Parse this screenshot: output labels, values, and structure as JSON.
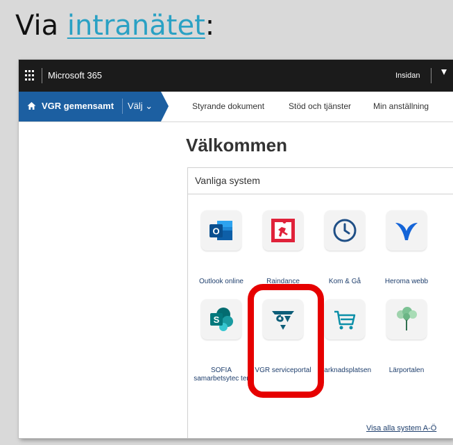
{
  "heading": {
    "prefix": "Via ",
    "link": "intranätet",
    "suffix": ":"
  },
  "suitebar": {
    "app_name": "Microsoft 365",
    "site_link": "Insidan"
  },
  "navbar": {
    "home_label": "VGR gemensamt",
    "select_label": "Välj ⌄",
    "links": [
      "Styrande dokument",
      "Stöd och tjänster",
      "Min anställning"
    ]
  },
  "main": {
    "welcome": "Välkommen",
    "panel_title": "Vanliga system",
    "apps": [
      {
        "label": "Outlook online",
        "icon": "outlook-icon"
      },
      {
        "label": "Raindance",
        "icon": "raindance-icon"
      },
      {
        "label": "Kom & Gå",
        "icon": "clock-icon"
      },
      {
        "label": "Heroma webb",
        "icon": "heroma-icon"
      },
      {
        "label": "SOFIA samarbetsytec ter",
        "icon": "sharepoint-icon"
      },
      {
        "label": "VGR serviceportal",
        "icon": "vgr-icon"
      },
      {
        "label": "Marknadsplatsen",
        "icon": "cart-icon"
      },
      {
        "label": "Lärportalen",
        "icon": "tree-icon"
      }
    ],
    "footer_link": "Visa alla system A-Ö"
  },
  "colors": {
    "suite_bar": "#1b1b1b",
    "home_button": "#1c5fa1",
    "highlight": "#e60000",
    "link": "#2aa1c4"
  }
}
